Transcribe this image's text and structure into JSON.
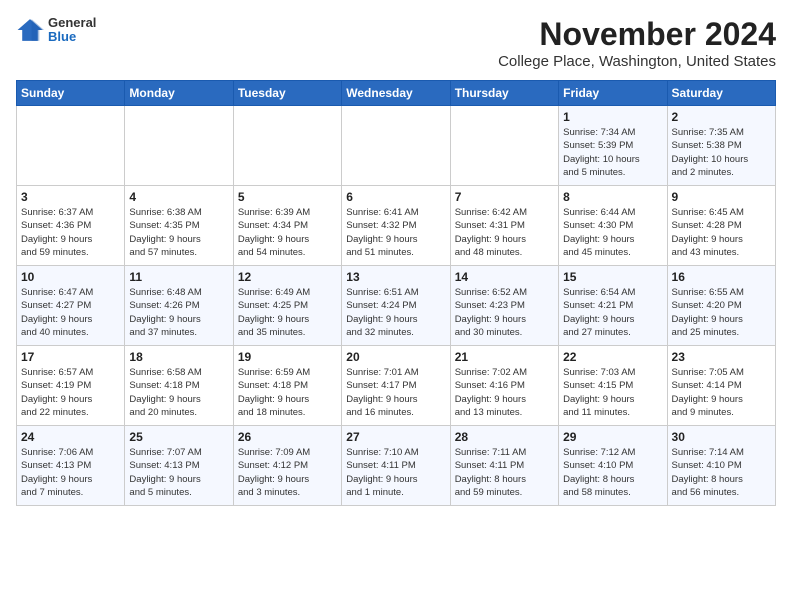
{
  "logo": {
    "general": "General",
    "blue": "Blue"
  },
  "title": "November 2024",
  "location": "College Place, Washington, United States",
  "weekdays": [
    "Sunday",
    "Monday",
    "Tuesday",
    "Wednesday",
    "Thursday",
    "Friday",
    "Saturday"
  ],
  "weeks": [
    [
      {
        "day": "",
        "info": ""
      },
      {
        "day": "",
        "info": ""
      },
      {
        "day": "",
        "info": ""
      },
      {
        "day": "",
        "info": ""
      },
      {
        "day": "",
        "info": ""
      },
      {
        "day": "1",
        "info": "Sunrise: 7:34 AM\nSunset: 5:39 PM\nDaylight: 10 hours\nand 5 minutes."
      },
      {
        "day": "2",
        "info": "Sunrise: 7:35 AM\nSunset: 5:38 PM\nDaylight: 10 hours\nand 2 minutes."
      }
    ],
    [
      {
        "day": "3",
        "info": "Sunrise: 6:37 AM\nSunset: 4:36 PM\nDaylight: 9 hours\nand 59 minutes."
      },
      {
        "day": "4",
        "info": "Sunrise: 6:38 AM\nSunset: 4:35 PM\nDaylight: 9 hours\nand 57 minutes."
      },
      {
        "day": "5",
        "info": "Sunrise: 6:39 AM\nSunset: 4:34 PM\nDaylight: 9 hours\nand 54 minutes."
      },
      {
        "day": "6",
        "info": "Sunrise: 6:41 AM\nSunset: 4:32 PM\nDaylight: 9 hours\nand 51 minutes."
      },
      {
        "day": "7",
        "info": "Sunrise: 6:42 AM\nSunset: 4:31 PM\nDaylight: 9 hours\nand 48 minutes."
      },
      {
        "day": "8",
        "info": "Sunrise: 6:44 AM\nSunset: 4:30 PM\nDaylight: 9 hours\nand 45 minutes."
      },
      {
        "day": "9",
        "info": "Sunrise: 6:45 AM\nSunset: 4:28 PM\nDaylight: 9 hours\nand 43 minutes."
      }
    ],
    [
      {
        "day": "10",
        "info": "Sunrise: 6:47 AM\nSunset: 4:27 PM\nDaylight: 9 hours\nand 40 minutes."
      },
      {
        "day": "11",
        "info": "Sunrise: 6:48 AM\nSunset: 4:26 PM\nDaylight: 9 hours\nand 37 minutes."
      },
      {
        "day": "12",
        "info": "Sunrise: 6:49 AM\nSunset: 4:25 PM\nDaylight: 9 hours\nand 35 minutes."
      },
      {
        "day": "13",
        "info": "Sunrise: 6:51 AM\nSunset: 4:24 PM\nDaylight: 9 hours\nand 32 minutes."
      },
      {
        "day": "14",
        "info": "Sunrise: 6:52 AM\nSunset: 4:23 PM\nDaylight: 9 hours\nand 30 minutes."
      },
      {
        "day": "15",
        "info": "Sunrise: 6:54 AM\nSunset: 4:21 PM\nDaylight: 9 hours\nand 27 minutes."
      },
      {
        "day": "16",
        "info": "Sunrise: 6:55 AM\nSunset: 4:20 PM\nDaylight: 9 hours\nand 25 minutes."
      }
    ],
    [
      {
        "day": "17",
        "info": "Sunrise: 6:57 AM\nSunset: 4:19 PM\nDaylight: 9 hours\nand 22 minutes."
      },
      {
        "day": "18",
        "info": "Sunrise: 6:58 AM\nSunset: 4:18 PM\nDaylight: 9 hours\nand 20 minutes."
      },
      {
        "day": "19",
        "info": "Sunrise: 6:59 AM\nSunset: 4:18 PM\nDaylight: 9 hours\nand 18 minutes."
      },
      {
        "day": "20",
        "info": "Sunrise: 7:01 AM\nSunset: 4:17 PM\nDaylight: 9 hours\nand 16 minutes."
      },
      {
        "day": "21",
        "info": "Sunrise: 7:02 AM\nSunset: 4:16 PM\nDaylight: 9 hours\nand 13 minutes."
      },
      {
        "day": "22",
        "info": "Sunrise: 7:03 AM\nSunset: 4:15 PM\nDaylight: 9 hours\nand 11 minutes."
      },
      {
        "day": "23",
        "info": "Sunrise: 7:05 AM\nSunset: 4:14 PM\nDaylight: 9 hours\nand 9 minutes."
      }
    ],
    [
      {
        "day": "24",
        "info": "Sunrise: 7:06 AM\nSunset: 4:13 PM\nDaylight: 9 hours\nand 7 minutes."
      },
      {
        "day": "25",
        "info": "Sunrise: 7:07 AM\nSunset: 4:13 PM\nDaylight: 9 hours\nand 5 minutes."
      },
      {
        "day": "26",
        "info": "Sunrise: 7:09 AM\nSunset: 4:12 PM\nDaylight: 9 hours\nand 3 minutes."
      },
      {
        "day": "27",
        "info": "Sunrise: 7:10 AM\nSunset: 4:11 PM\nDaylight: 9 hours\nand 1 minute."
      },
      {
        "day": "28",
        "info": "Sunrise: 7:11 AM\nSunset: 4:11 PM\nDaylight: 8 hours\nand 59 minutes."
      },
      {
        "day": "29",
        "info": "Sunrise: 7:12 AM\nSunset: 4:10 PM\nDaylight: 8 hours\nand 58 minutes."
      },
      {
        "day": "30",
        "info": "Sunrise: 7:14 AM\nSunset: 4:10 PM\nDaylight: 8 hours\nand 56 minutes."
      }
    ]
  ]
}
